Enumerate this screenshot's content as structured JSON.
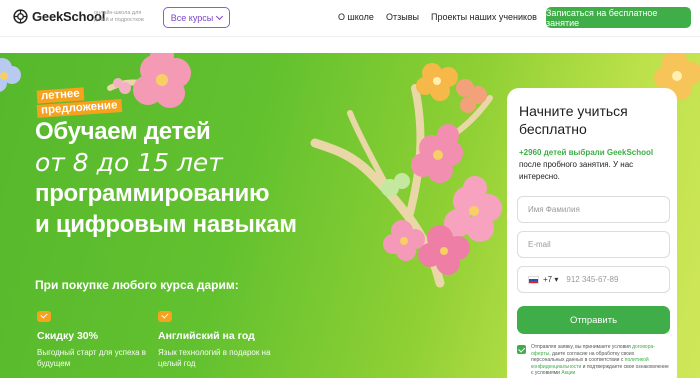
{
  "header": {
    "logo_name": "GeekSchool",
    "logo_tagline": "онлайн-школа для детей и подростков",
    "courses_button": "Все курсы",
    "nav": [
      {
        "label": "О школе"
      },
      {
        "label": "Отзывы"
      },
      {
        "label": "Проекты наших учеников"
      }
    ],
    "cta": "Записаться на бесплатное занятие"
  },
  "hero": {
    "badge_line1": "летнее",
    "badge_line2": "предложение",
    "title_line1": "Обучаем детей",
    "title_line2": "от 8 до 15 лет",
    "title_line3": "программированию",
    "title_line4": "и цифровым навыкам",
    "gift_label": "При покупке любого курса дарим:",
    "perks": [
      {
        "title": "Скидку 30%",
        "text": "Выгодный старт для успеха в будущем"
      },
      {
        "title": "Английский на год",
        "text": "Язык технологий в подарок на целый год"
      }
    ]
  },
  "form": {
    "title": "Начните учиться бесплатно",
    "sub_highlight": "+2960 детей выбрали GeekSchool",
    "sub_rest": " после пробного занятия. У нас интересно.",
    "name_placeholder": "Имя Фамилия",
    "email_placeholder": "E-mail",
    "phone_code": "+7",
    "phone_placeholder": "912 345-67-89",
    "submit": "Отправить",
    "consent_part1": "Отправляя заявку, вы принимаете условия ",
    "consent_link1": "договора-оферты",
    "consent_part2": ", даете согласие на обработку своих персональных данных в соответствии с ",
    "consent_link2": "политикой конфиденциальности",
    "consent_part3": " и подтверждаете свое ознакомление с условиями ",
    "consent_link3": "Акции"
  },
  "colors": {
    "accent_green": "#3fae49",
    "accent_purple": "#7b46c7",
    "badge_orange": "#f6a21f",
    "hero_green": "#62c12f"
  },
  "icons": [
    "geekschool-logo-icon",
    "chevron-down-icon",
    "checkmark-icon",
    "russia-flag-icon",
    "checkbox-icon"
  ]
}
